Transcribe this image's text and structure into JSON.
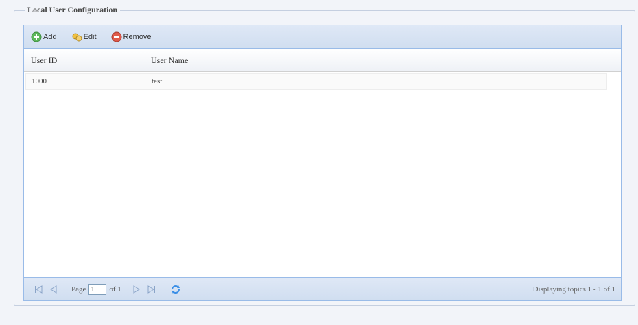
{
  "fieldset": {
    "legend": "Local User Configuration"
  },
  "toolbar": {
    "add_label": "Add",
    "edit_label": "Edit",
    "remove_label": "Remove"
  },
  "table": {
    "columns": [
      "User ID",
      "User Name"
    ],
    "rows": [
      {
        "user_id": "1000",
        "user_name": "test"
      }
    ]
  },
  "pager": {
    "page_label": "Page",
    "page_value": "1",
    "of_label": "of 1",
    "display_msg": "Displaying topics 1 - 1 of 1"
  }
}
